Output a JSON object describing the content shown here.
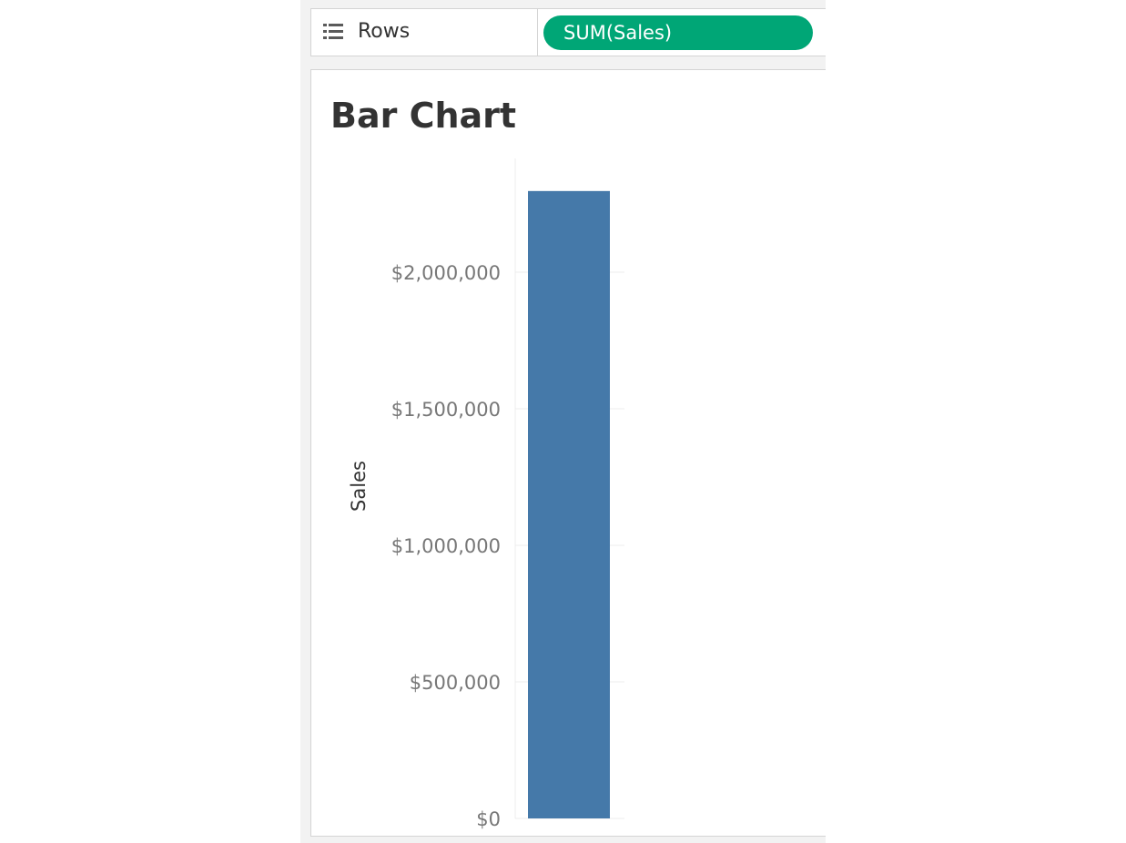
{
  "shelf": {
    "label": "Rows",
    "icon": "rows-list-icon",
    "pill_label": "SUM(Sales)",
    "pill_color": "#00a676"
  },
  "chart_data": {
    "type": "bar",
    "title": "Bar Chart",
    "ylabel": "Sales",
    "xlabel": "",
    "categories": [
      ""
    ],
    "values": [
      2297201
    ],
    "ylim": [
      0,
      2400000
    ],
    "yticks": [
      0,
      500000,
      1000000,
      1500000,
      2000000
    ],
    "ytick_labels": [
      "$0",
      "$500,000",
      "$1,000,000",
      "$1,500,000",
      "$2,000,000"
    ],
    "bar_color": "#4579a9",
    "grid": true
  }
}
